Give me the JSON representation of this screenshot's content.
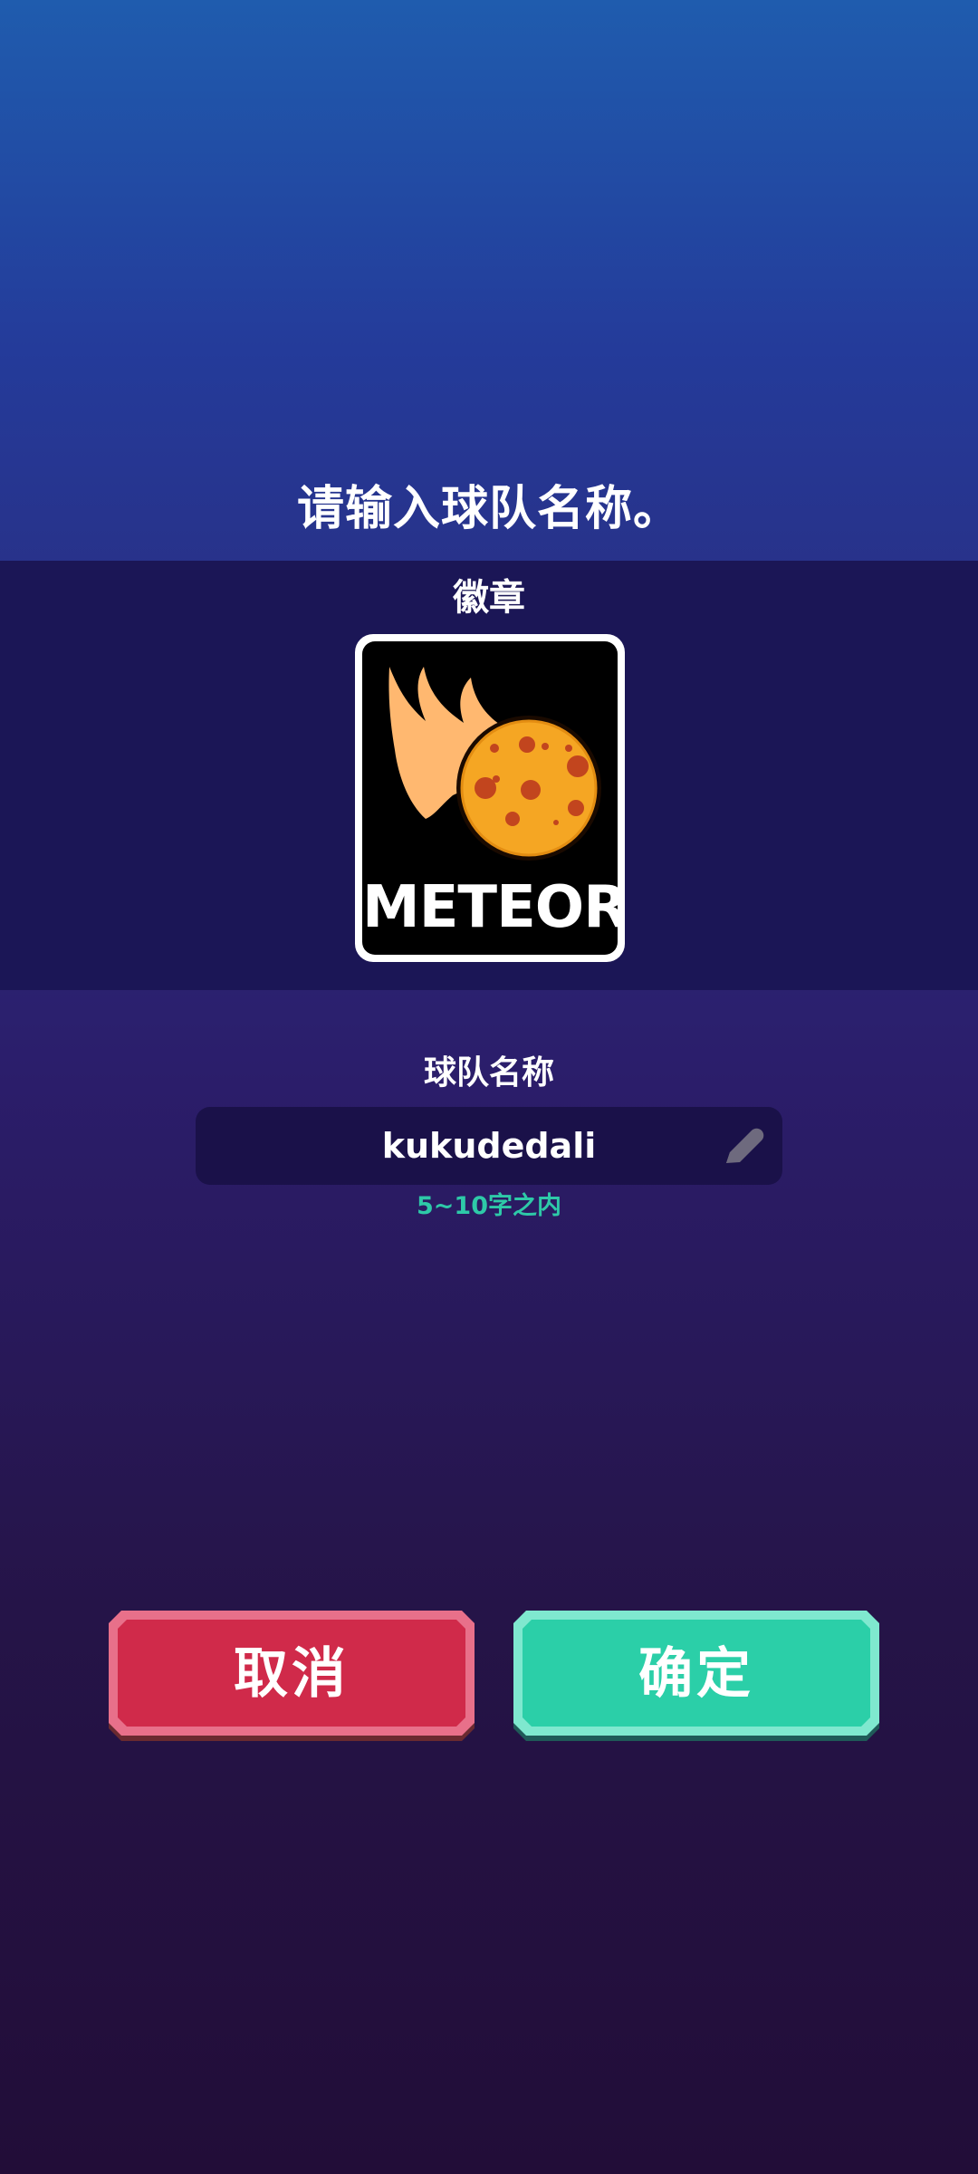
{
  "dialog": {
    "title": "请输入球队名称。",
    "badge_label": "徽章",
    "badge": {
      "icon": "meteor-badge",
      "text": "METEOR",
      "colors": {
        "flame": "#ffb870",
        "planet": "#f5a623",
        "crater": "#c2451e"
      }
    },
    "team_name_label": "球队名称",
    "team_name_value": "kukudedali",
    "team_name_hint": "5~10字之内",
    "edit_icon": "pencil-icon",
    "cancel_label": "取消",
    "confirm_label": "确定"
  },
  "colors": {
    "cancel": "#d02a4a",
    "confirm": "#2bcfa8",
    "hint": "#2ec9a8",
    "field_bg": "#1a1149",
    "band_bg": "#1b1656"
  }
}
